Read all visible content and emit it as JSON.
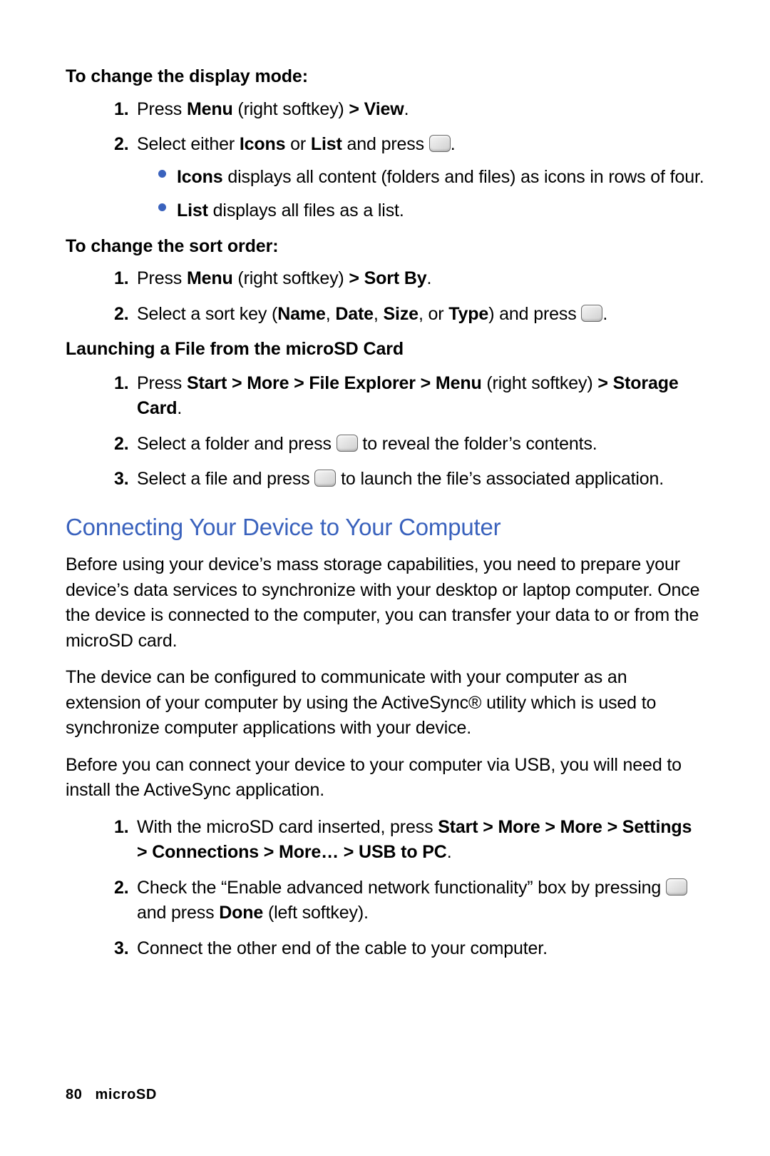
{
  "sections": {
    "displayMode": {
      "title": "To change the display mode:",
      "steps": [
        {
          "marker": "1.",
          "pre": "Press ",
          "b1": "Menu",
          "mid1": " (right softkey) ",
          "b2": "> View",
          "post": "."
        },
        {
          "marker": "2.",
          "pre": "Select either ",
          "b1": "Icons",
          "mid1": " or ",
          "b2": "List",
          "mid2": " and press ",
          "post": "."
        }
      ],
      "bullets": [
        {
          "b": "Icons",
          "rest": " displays all content (folders and files) as icons in rows of four."
        },
        {
          "b": "List",
          "rest": " displays all files as a list."
        }
      ]
    },
    "sortOrder": {
      "title": "To change the sort order:",
      "steps": [
        {
          "marker": "1.",
          "pre": "Press ",
          "b1": "Menu",
          "mid1": " (right softkey) ",
          "b2": "> Sort By",
          "post": "."
        },
        {
          "marker": "2.",
          "pre": "Select a sort key (",
          "b1": "Name",
          "c1": ", ",
          "b2": "Date",
          "c2": ", ",
          "b3": "Size",
          "c3": ", or ",
          "b4": "Type",
          "mid2": ") and press ",
          "post": "."
        }
      ]
    },
    "launching": {
      "title": "Launching a File from the microSD Card",
      "steps": [
        {
          "marker": "1.",
          "pre": "Press ",
          "b1": "Start > More > File Explorer > Menu",
          "mid1": " (right softkey) ",
          "b2": "> Storage Card",
          "post": "."
        },
        {
          "marker": "2.",
          "pre": "Select a folder and press ",
          "post": " to reveal the folder’s contents."
        },
        {
          "marker": "3.",
          "pre": "Select a file and press ",
          "post": " to launch the file’s associated application."
        }
      ]
    },
    "connecting": {
      "title": "Connecting Your Device to Your Computer",
      "p1": "Before using your device’s mass storage capabilities, you need to prepare your device’s data services to synchronize with your desktop or laptop computer. Once the device is connected to the computer, you can transfer your data to or from the microSD card.",
      "p2": "The device can be configured to communicate with your computer as an extension of your computer by using the ActiveSync® utility which is used to synchronize computer applications with your device.",
      "p3": "Before you can connect your device to your computer via USB, you will need to install the ActiveSync application.",
      "steps": [
        {
          "marker": "1.",
          "pre": "With the microSD card inserted, press ",
          "b1": "Start > More > More > Settings > Connections > More… > USB to PC",
          "post": "."
        },
        {
          "marker": "2.",
          "pre": "Check the “Enable advanced network functionality” box by pressing ",
          "mid2": " and press ",
          "b2": "Done",
          "post": " (left softkey)."
        },
        {
          "marker": "3.",
          "pre": "Connect the other end of the cable to your computer."
        }
      ]
    }
  },
  "footer": {
    "page": "80",
    "section": "microSD"
  }
}
